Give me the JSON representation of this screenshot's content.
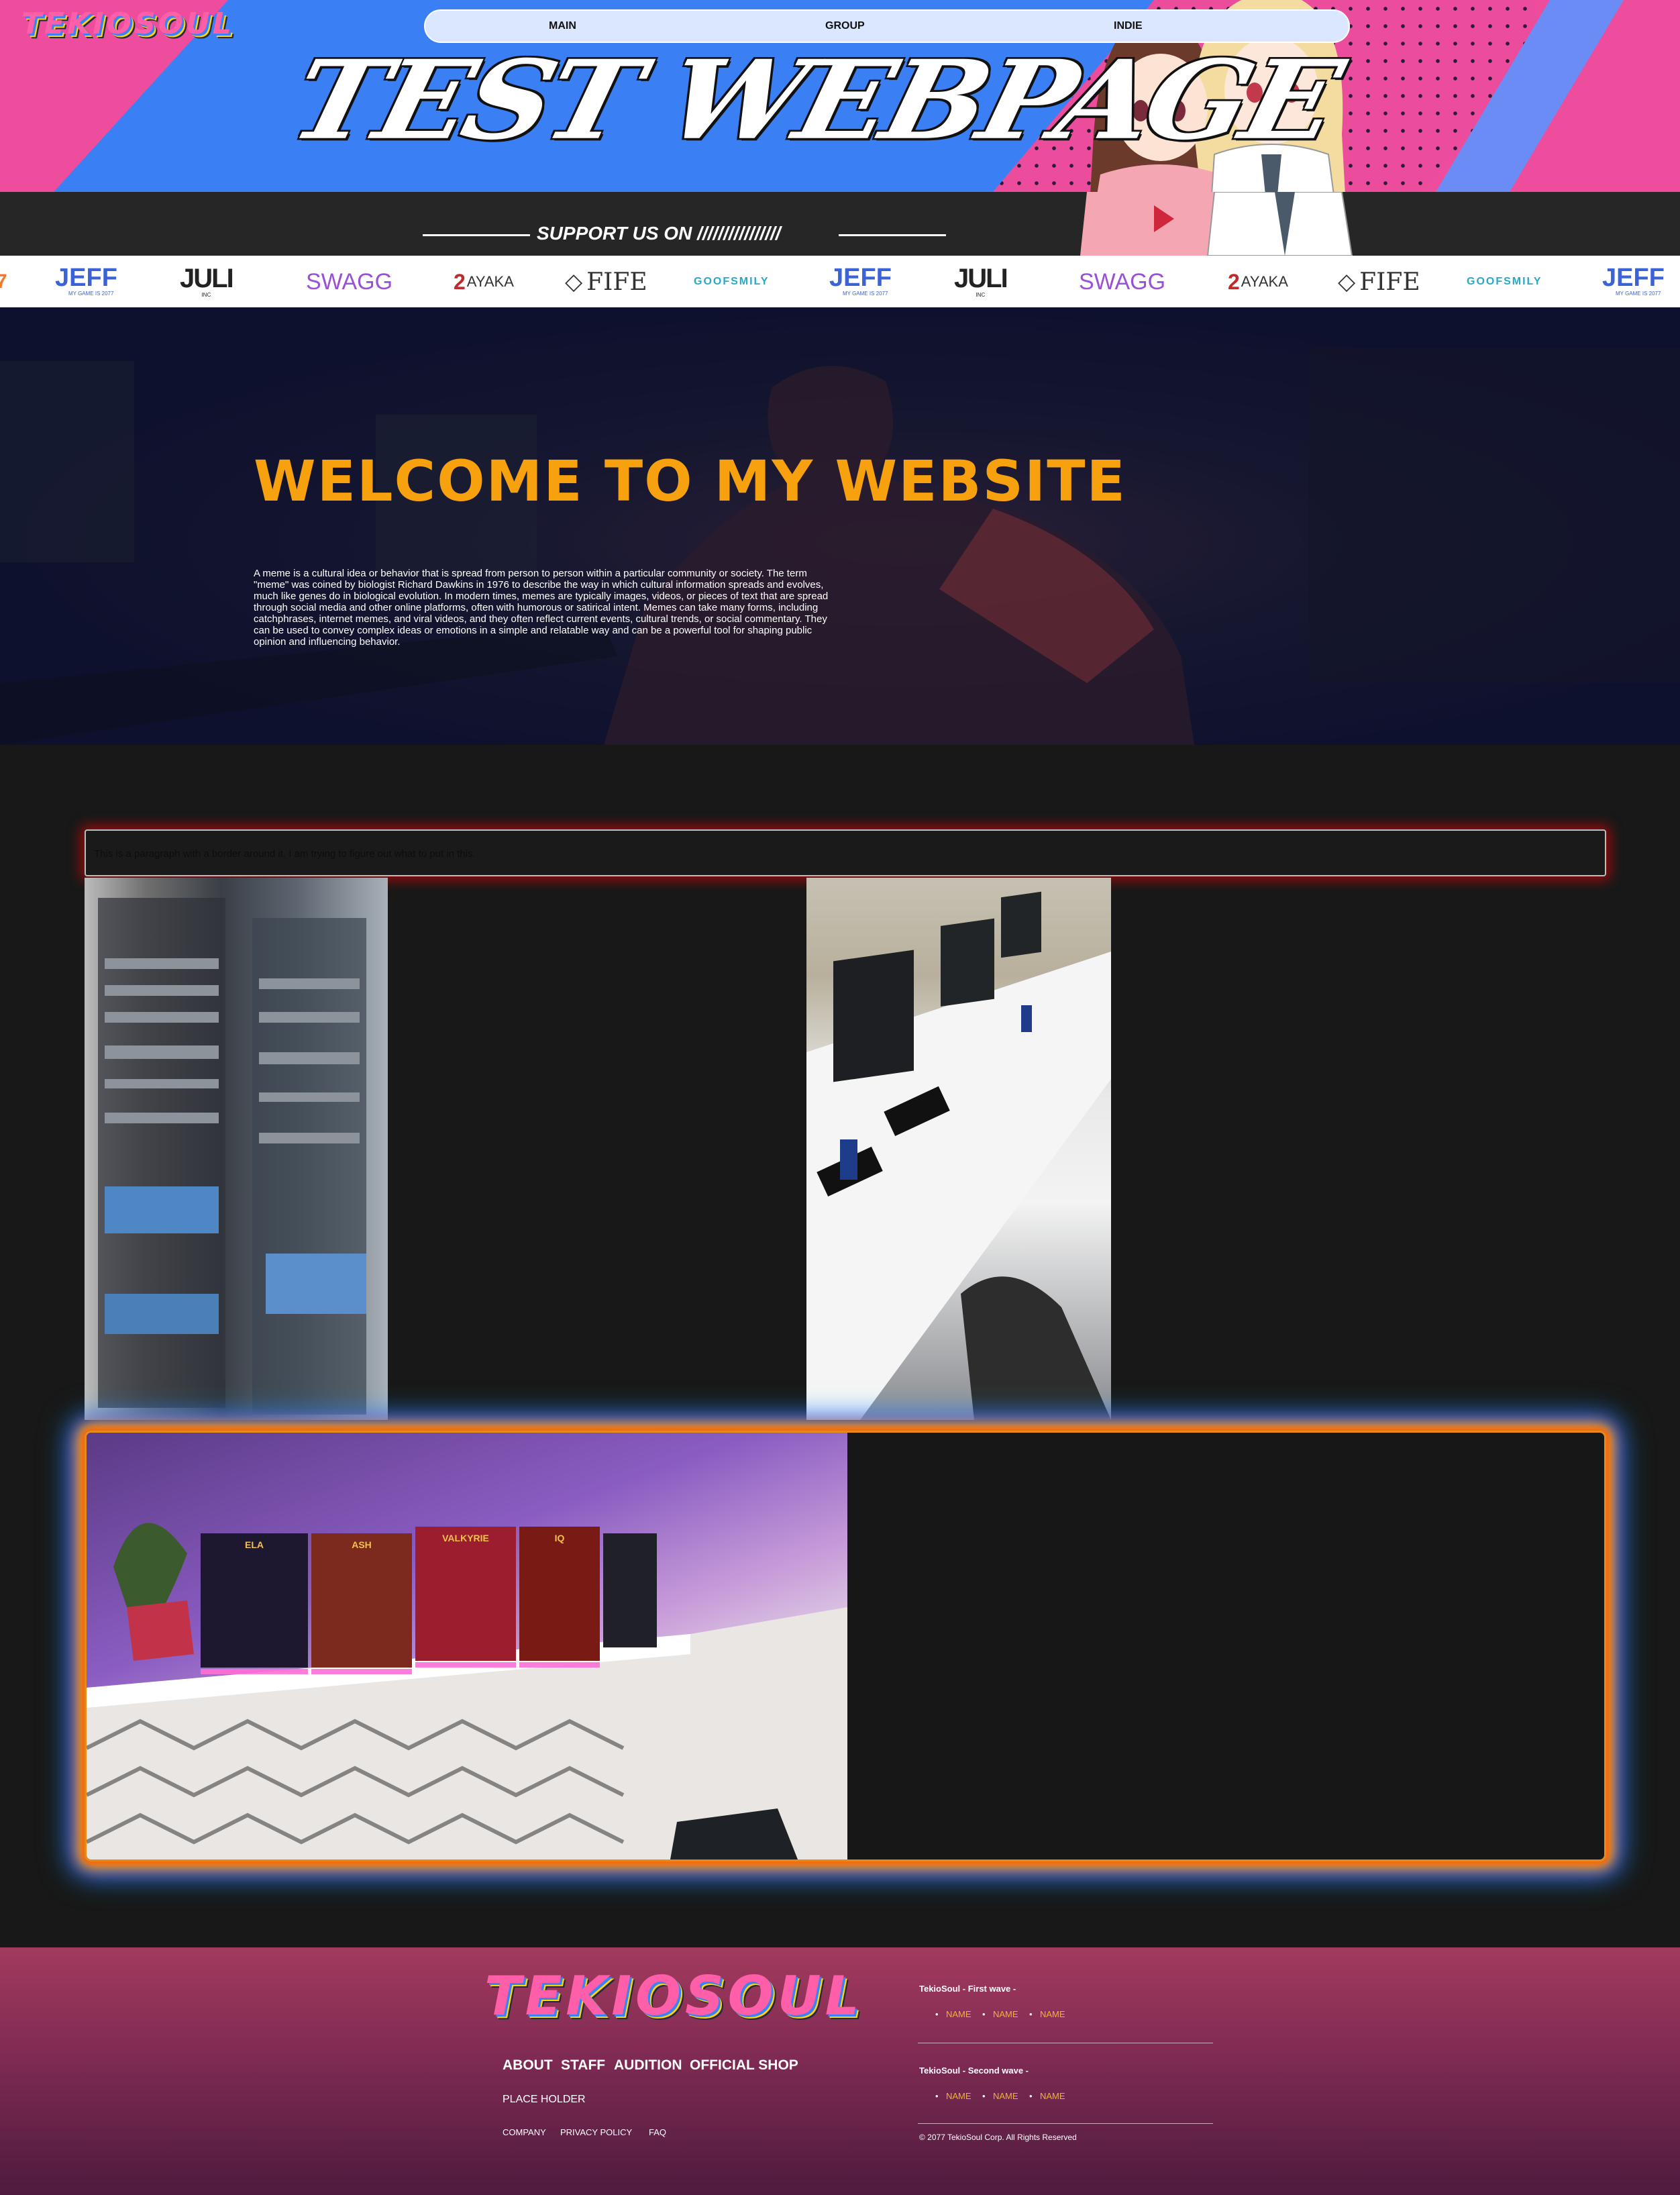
{
  "header": {
    "logo": "TEKIOSOUL",
    "title": "TEST WEBPAGE",
    "nav": [
      "MAIN",
      "GROUP",
      "INDIE"
    ],
    "support_label": "SUPPORT US ON  ////////////////"
  },
  "sponsors": [
    {
      "name": "JEFF",
      "sub": "MY GAME IS 2077"
    },
    {
      "name": "JULI",
      "sub": "INC"
    },
    {
      "name": "SWAGG",
      "sub": ""
    },
    {
      "name": "AYAKA",
      "sub": ""
    },
    {
      "name": "FIFE",
      "sub": ""
    },
    {
      "name": "GOOFSMILY",
      "sub": ""
    }
  ],
  "hero": {
    "title": "WELCOME TO MY WEBSITE",
    "text": "A meme is a cultural idea or behavior that is spread from person to person within a particular community or society. The term \"meme\" was coined by biologist Richard Dawkins in 1976 to describe the way in which cultural information spreads and evolves, much like genes do in biological evolution. In modern times, memes are typically images, videos, or pieces of text that are spread through social media and other online platforms, often with humorous or satirical intent. Memes can take many forms, including catchphrases, internet memes, and viral videos, and they often reflect current events, cultural trends, or social commentary. They can be used to convey complex ideas or emotions in a simple and relatable way and can be a powerful tool for shaping public opinion and influencing behavior."
  },
  "main": {
    "bordered_paragraph": "This is a paragraph with a border around it. I am trying to figure out what to put in this.",
    "figure_labels": [
      "ELA",
      "ASH",
      "VALKYRIE",
      "IQ"
    ]
  },
  "footer": {
    "logo": "TEKIOSOUL",
    "links": [
      "ABOUT",
      "STAFF",
      "AUDITION",
      "OFFICIAL SHOP"
    ],
    "placeholder": "PLACE HOLDER",
    "small_links": [
      "COMPANY",
      "PRIVACY POLICY",
      "FAQ"
    ],
    "first_wave_title": "TekioSoul - First wave -",
    "first_wave_names": [
      "NAME",
      "NAME",
      "NAME"
    ],
    "second_wave_title": "TekioSoul - Second wave -",
    "second_wave_names": [
      "NAME",
      "NAME",
      "NAME"
    ],
    "copyright": "© 2077 TekioSoul Corp. All Rights Reserved"
  },
  "colors": {
    "accent_orange": "#f7a10e",
    "header_blue": "#3b82f6",
    "header_pink": "#ee4d9e",
    "footer_name": "#f0b432"
  }
}
